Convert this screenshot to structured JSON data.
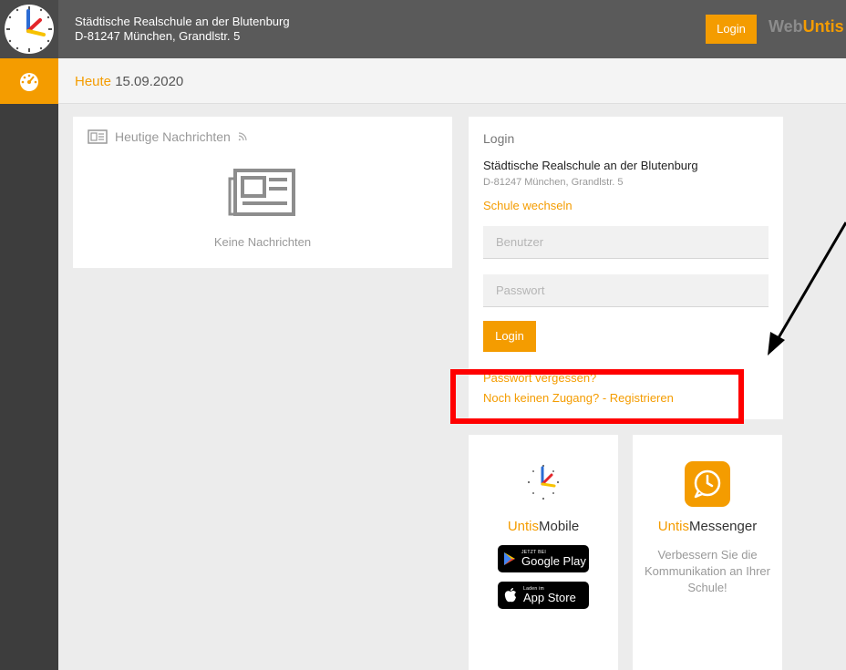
{
  "header": {
    "school_name": "Städtische Realschule an der Blutenburg",
    "school_address": "D-81247 München, Grandlstr. 5",
    "login_label": "Login",
    "brand_web": "Web",
    "brand_untis": "Untis"
  },
  "subheader": {
    "today_label": "Heute",
    "date": "15.09.2020"
  },
  "news": {
    "title": "Heutige Nachrichten",
    "empty_text": "Keine Nachrichten"
  },
  "login_card": {
    "title": "Login",
    "school_name": "Städtische Realschule an der Blutenburg",
    "school_address": "D-81247 München, Grandlstr. 5",
    "switch_school": "Schule wechseln",
    "username_placeholder": "Benutzer",
    "password_placeholder": "Passwort",
    "login_button": "Login",
    "forgot_password": "Passwort vergessen?",
    "register": "Noch keinen Zugang? - Registrieren"
  },
  "untis_mobile": {
    "name_accent": "Untis",
    "name_rest": "Mobile",
    "google_small": "JETZT BEI",
    "google_big": "Google Play",
    "apple_small": "Laden im",
    "apple_big": "App Store"
  },
  "untis_messenger": {
    "name_accent": "Untis",
    "name_rest": "Messenger",
    "description": "Verbessern Sie die Kommunikation an Ihrer Schule!"
  },
  "colors": {
    "accent": "#f49c00",
    "header_bg": "#5a5a5a",
    "sidebar_bg": "#3d3d3d",
    "annotation": "#ff0000"
  },
  "icons": {
    "logo": "untis-clock-logo-icon",
    "sidebar_dashboard": "speedometer-icon",
    "news": "newspaper-icon",
    "rss": "rss-icon",
    "google_play": "play-triangle-icon",
    "apple": "apple-icon",
    "messenger": "chat-clock-icon"
  }
}
